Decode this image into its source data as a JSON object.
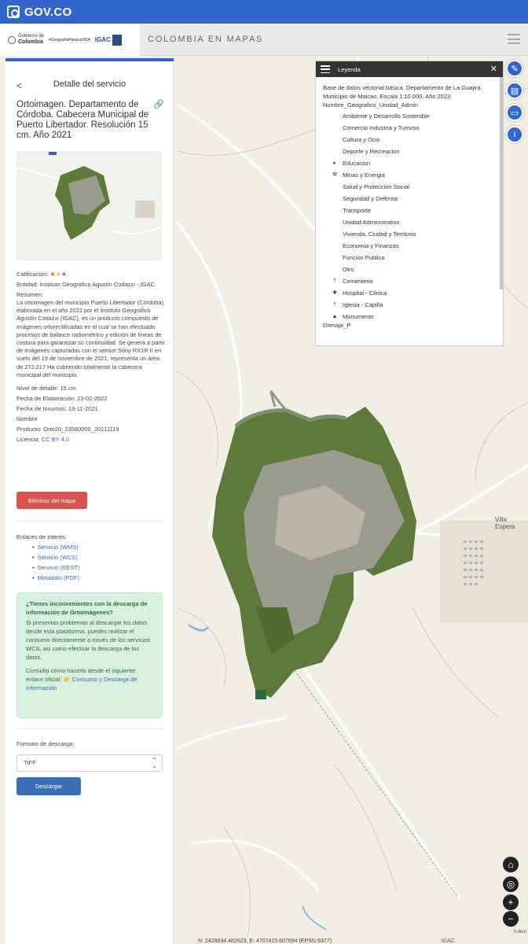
{
  "govbar": {
    "brand": "GOV.CO"
  },
  "header": {
    "gobierno_line1": "Gobierno de",
    "gobierno_line2": "Colombia",
    "geografia_text": "#GeografíaParaLaVIDA",
    "igac_text": "IGAC",
    "title": "COLOMBIA EN MAPAS"
  },
  "panel": {
    "back_glyph": "<",
    "title": "Detalle del servicio",
    "service_title": "Ortoimagen. Departamento de Córdoba. Cabecera Municipal de Puerto Libertador. Resolución 15 cm. Año 2021",
    "calificacion_label": "Calificación:",
    "entidad": "Entidad: Instituto Geográfico Agustín Codazzi - IGAC",
    "resumen_label": "Resumen:",
    "resumen": "La ortoimagen del municipio Puerto Libertador (Córdoba), elaborada en el año 2022 por el Instituto Geográfico Agustín Codazzi (IGAC), es un producto compuesto de imágenes ortorectificadas en el cual se han efectuado procesos de balance radiométrico y edición de líneas de costura para garantizar su continuidad. Se genera a partir de imágenes capturadas con el sensor Sony RX1R II en vuelo del 19 de noviembre de 2021, representa un área de 272.217 Ha cubriendo totalmente la cabecera municipal del municipio.",
    "nivel": "Nivel de detalle: 15 cm",
    "fecha_elab": "Fecha de Elaboración: 23-02-2022",
    "fecha_insumos": "Fecha de Insumos: 19-11-2021",
    "nombre": "Nombre",
    "producto": "Producto: Orto20_23580000_20211119",
    "licencia_label": "Licencia:",
    "licencia_value": "CC BY 4.0",
    "remove_button": "Eliminar del mapa",
    "enlaces_label": "Enlaces de interés:",
    "enlaces": [
      "Servicio (WMS)",
      "Servicio (WCS)",
      "Servicio (REST)",
      "Metadato (PDF)"
    ],
    "alert_heading": "¿Tienes inconvenientes con la descarga de información de Ortoimágenes?",
    "alert_body": "Si presentas problemas al descargar los datos desde esta plataforma, puedes realizar el consumo directamente a través de los servicios WCS, así como efectuar la descarga de los datos.",
    "alert_link_intro": "Consulta cómo hacerlo desde el siguiente enlace oficial: 👉",
    "alert_link": "Consumo y Descarga de Información",
    "formato_label": "Formato de descarga:",
    "formato_value": "TIFF",
    "download_button": "Descargar"
  },
  "legend": {
    "title": "Leyenda",
    "description": "Base de datos vectorial básica. Departamento de La Guajira. Municipio de Maicao. Escala 1:10.000. Año 2023",
    "group": "Nombre_Geografico_Unidad_Admin",
    "items": [
      {
        "label": "Ambiente y Desarrollo Sostenible",
        "symbol": ""
      },
      {
        "label": "Comercio Industria y Turismo",
        "symbol": ""
      },
      {
        "label": "Cultura y Ocio",
        "symbol": ""
      },
      {
        "label": "Deporte y Recreacion",
        "symbol": ""
      },
      {
        "label": "Educacion",
        "symbol": "▸"
      },
      {
        "label": "Minas y Energia",
        "symbol": "⚒"
      },
      {
        "label": "Salud y Proteccion Social",
        "symbol": ""
      },
      {
        "label": "Seguridad y Defensa",
        "symbol": ""
      },
      {
        "label": "Transporte",
        "symbol": ""
      },
      {
        "label": "Unidad Administrativo",
        "symbol": ""
      },
      {
        "label": "Vivienda, Ciudad y Territorio",
        "symbol": ""
      },
      {
        "label": "Economia y Finanzas",
        "symbol": ""
      },
      {
        "label": "Funcion Publica",
        "symbol": ""
      },
      {
        "label": "Otro",
        "symbol": ""
      },
      {
        "label": "Cementerio",
        "symbol": "†"
      },
      {
        "label": "Hospital - Clinica",
        "symbol": "✚"
      },
      {
        "label": "Iglesia - Capilla",
        "symbol": "†"
      },
      {
        "label": "Monumento",
        "symbol": "▲"
      }
    ],
    "trailing": "Drenaje_P"
  },
  "map": {
    "place_label": "Villa Espera",
    "coords": "N: 2428634.482623, E: 4707415.607694 (EPSG:9377)",
    "attribution": "IGAC",
    "scale": "0.4km"
  },
  "colors": {
    "gov_blue": "#3366cc",
    "danger": "#d9534f",
    "primary": "#3a6fb6",
    "alert_bg": "#d9f2e0"
  }
}
